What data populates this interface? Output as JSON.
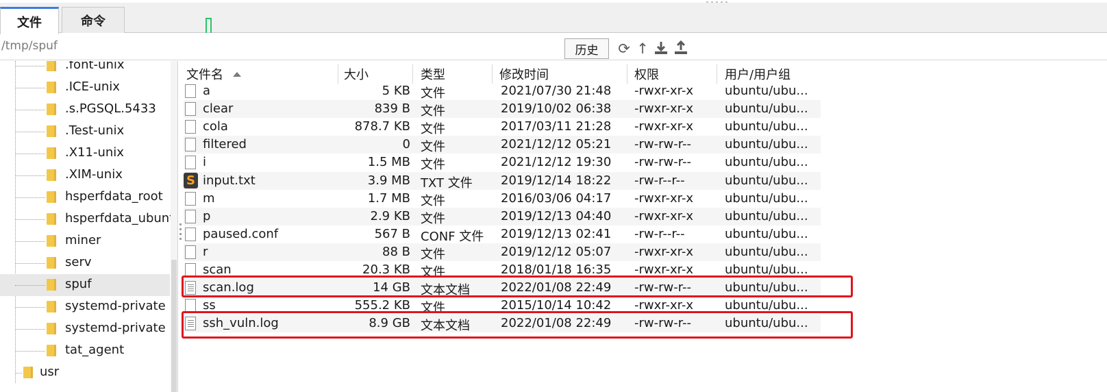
{
  "tabs": [
    {
      "label": "文件",
      "active": true
    },
    {
      "label": "命令",
      "active": false
    }
  ],
  "path": {
    "value": "/tmp/spuf",
    "history_label": "历史"
  },
  "toolbar_icons": [
    "refresh-icon",
    "up-arrow-icon",
    "download-icon",
    "upload-icon"
  ],
  "tree": {
    "items": [
      {
        "label": ".font-unix"
      },
      {
        "label": ".ICE-unix"
      },
      {
        "label": ".s.PGSQL.5433"
      },
      {
        "label": ".Test-unix"
      },
      {
        "label": ".X11-unix"
      },
      {
        "label": ".XIM-unix"
      },
      {
        "label": "hsperfdata_root"
      },
      {
        "label": "hsperfdata_ubuntu"
      },
      {
        "label": "miner"
      },
      {
        "label": "serv"
      },
      {
        "label": "spuf",
        "selected": true
      },
      {
        "label": "systemd-private"
      },
      {
        "label": "systemd-private"
      },
      {
        "label": "tat_agent"
      }
    ],
    "parent_item": {
      "label": "usr"
    }
  },
  "columns": {
    "name": "文件名",
    "size": "大小",
    "type": "类型",
    "modified": "修改时间",
    "permissions": "权限",
    "owner": "用户/用户组"
  },
  "files": [
    {
      "name": "a",
      "size": "5 KB",
      "type": "文件",
      "modified": "2021/07/30 21:48",
      "perm": "-rwxr-xr-x",
      "owner": "ubuntu/ubu...",
      "icon": "file-icon"
    },
    {
      "name": "clear",
      "size": "839 B",
      "type": "文件",
      "modified": "2019/10/02 06:38",
      "perm": "-rwxr-xr-x",
      "owner": "ubuntu/ubu...",
      "icon": "file-icon"
    },
    {
      "name": "cola",
      "size": "878.7 KB",
      "type": "文件",
      "modified": "2017/03/11 21:28",
      "perm": "-rwxr-xr-x",
      "owner": "ubuntu/ubu...",
      "icon": "file-icon"
    },
    {
      "name": "filtered",
      "size": "0",
      "type": "文件",
      "modified": "2021/12/12 05:21",
      "perm": "-rw-rw-r--",
      "owner": "ubuntu/ubu...",
      "icon": "file-icon"
    },
    {
      "name": "i",
      "size": "1.5 MB",
      "type": "文件",
      "modified": "2021/12/12 19:30",
      "perm": "-rw-rw-r--",
      "owner": "ubuntu/ubu...",
      "icon": "file-icon"
    },
    {
      "name": "input.txt",
      "size": "3.9 MB",
      "type": "TXT 文件",
      "modified": "2019/12/14 18:22",
      "perm": "-rw-r--r--",
      "owner": "ubuntu/ubu...",
      "icon": "sublime-icon"
    },
    {
      "name": "m",
      "size": "1.7 MB",
      "type": "文件",
      "modified": "2016/03/06 04:17",
      "perm": "-rwxr-xr-x",
      "owner": "ubuntu/ubu...",
      "icon": "file-icon"
    },
    {
      "name": "p",
      "size": "2.9 KB",
      "type": "文件",
      "modified": "2019/12/13 04:40",
      "perm": "-rwxr-xr-x",
      "owner": "ubuntu/ubu...",
      "icon": "file-icon"
    },
    {
      "name": "paused.conf",
      "size": "567 B",
      "type": "CONF 文件",
      "modified": "2019/12/13 02:41",
      "perm": "-rw-r--r--",
      "owner": "ubuntu/ubu...",
      "icon": "file-icon"
    },
    {
      "name": "r",
      "size": "88 B",
      "type": "文件",
      "modified": "2019/12/12 05:07",
      "perm": "-rwxr-xr-x",
      "owner": "ubuntu/ubu...",
      "icon": "file-icon"
    },
    {
      "name": "scan",
      "size": "20.3 KB",
      "type": "文件",
      "modified": "2018/01/18 16:35",
      "perm": "-rwxr-xr-x",
      "owner": "ubuntu/ubu...",
      "icon": "file-icon"
    },
    {
      "name": "scan.log",
      "size": "14 GB",
      "type": "文本文档",
      "modified": "2022/01/08 22:49",
      "perm": "-rw-rw-r--",
      "owner": "ubuntu/ubu...",
      "icon": "text-doc-icon",
      "highlighted": true
    },
    {
      "name": "ss",
      "size": "555.2 KB",
      "type": "文件",
      "modified": "2015/10/14 10:42",
      "perm": "-rwxr-xr-x",
      "owner": "ubuntu/ubu...",
      "icon": "file-icon"
    },
    {
      "name": "ssh_vuln.log",
      "size": "8.9 GB",
      "type": "文本文档",
      "modified": "2022/01/08 22:49",
      "perm": "-rw-rw-r--",
      "owner": "ubuntu/ubu...",
      "icon": "text-doc-icon",
      "highlighted": true
    }
  ],
  "colors": {
    "accent": "#3c7be0",
    "highlight": "#e0141c",
    "folder": "#f3c84a"
  }
}
